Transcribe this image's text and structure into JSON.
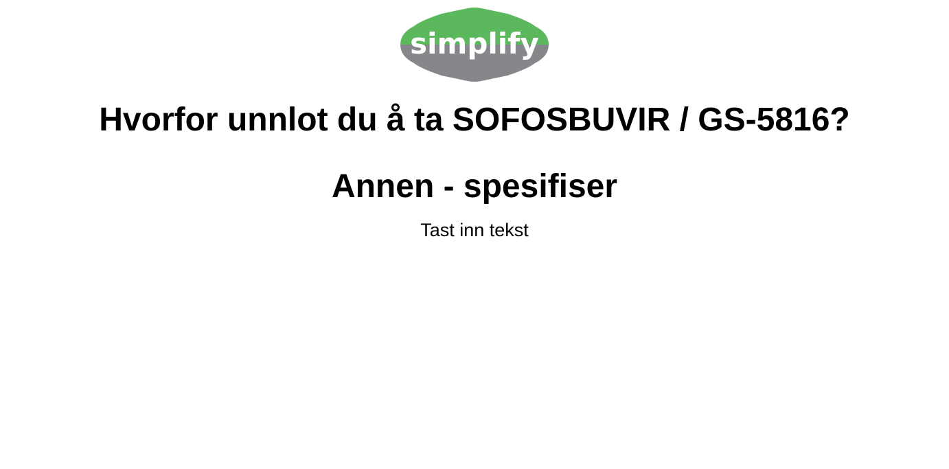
{
  "logo": {
    "text": "simplify",
    "colors": {
      "top": "#5cb85c",
      "bottom": "#86878b",
      "text": "#ffffff"
    }
  },
  "question": {
    "title": "Hvorfor unnlot du å ta SOFOSBUVIR / GS-5816?"
  },
  "answer": {
    "label": "Annen - spesifiser"
  },
  "input": {
    "placeholder": "Tast inn tekst",
    "value": ""
  }
}
